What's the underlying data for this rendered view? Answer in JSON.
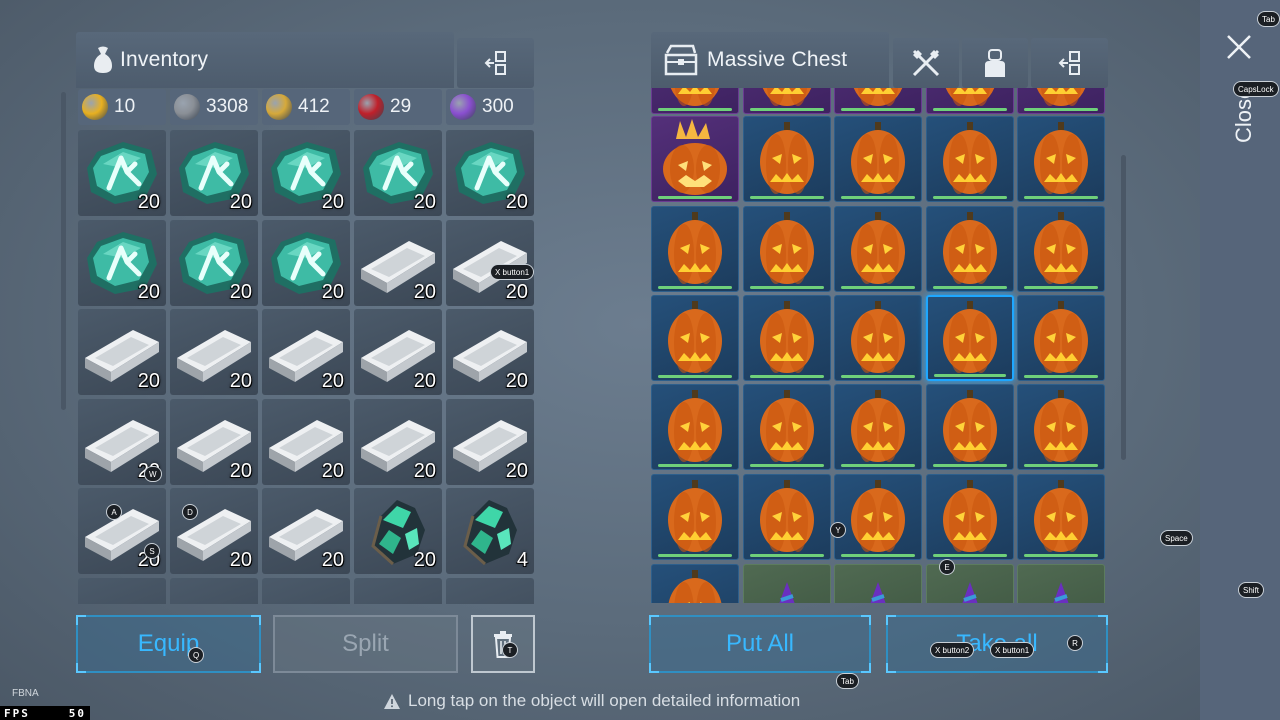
{
  "inventory": {
    "title": "Inventory",
    "currencies": [
      {
        "icon": "gold-coin-icon",
        "value": "10",
        "color": "#e8b020"
      },
      {
        "icon": "chip-icon",
        "value": "3308",
        "color": "#8a8f96"
      },
      {
        "icon": "crown-icon",
        "value": "412",
        "color": "#d6a93a"
      },
      {
        "icon": "red-emblem-icon",
        "value": "29",
        "color": "#c0202a"
      },
      {
        "icon": "crystal-icon",
        "value": "300",
        "color": "#8a4fd0"
      }
    ],
    "slots": [
      {
        "item": "rune-stone",
        "count": "20"
      },
      {
        "item": "rune-stone",
        "count": "20"
      },
      {
        "item": "rune-stone",
        "count": "20"
      },
      {
        "item": "rune-stone",
        "count": "20"
      },
      {
        "item": "rune-stone",
        "count": "20"
      },
      {
        "item": "rune-stone",
        "count": "20"
      },
      {
        "item": "rune-stone",
        "count": "20"
      },
      {
        "item": "rune-stone",
        "count": "20"
      },
      {
        "item": "metal-ingot",
        "count": "20"
      },
      {
        "item": "metal-ingot",
        "count": "20"
      },
      {
        "item": "metal-ingot",
        "count": "20"
      },
      {
        "item": "metal-ingot",
        "count": "20"
      },
      {
        "item": "metal-ingot",
        "count": "20"
      },
      {
        "item": "metal-ingot",
        "count": "20"
      },
      {
        "item": "metal-ingot",
        "count": "20"
      },
      {
        "item": "metal-ingot",
        "count": "20"
      },
      {
        "item": "metal-ingot",
        "count": "20"
      },
      {
        "item": "metal-ingot",
        "count": "20"
      },
      {
        "item": "metal-ingot",
        "count": "20"
      },
      {
        "item": "metal-ingot",
        "count": "20"
      },
      {
        "item": "metal-ingot",
        "count": "20"
      },
      {
        "item": "metal-ingot",
        "count": "20"
      },
      {
        "item": "metal-ingot",
        "count": "20"
      },
      {
        "item": "green-ore",
        "count": "20"
      },
      {
        "item": "green-ore",
        "count": "4"
      }
    ],
    "buttons": {
      "equip": "Equip",
      "split": "Split"
    }
  },
  "chest": {
    "title": "Massive Chest",
    "buttons": {
      "put_all": "Put All",
      "take_all": "Take all"
    }
  },
  "keys": {
    "tab": "Tab",
    "capslock": "CapsLock",
    "space": "Space",
    "shift": "Shift",
    "xbutton1": "X button1",
    "xbutton2": "X button2",
    "q": "Q",
    "t": "T",
    "w": "W",
    "a": "A",
    "d": "D",
    "s": "S",
    "y": "Y",
    "e": "E",
    "r": "R"
  },
  "close_label": "Close",
  "hint": "Long tap on the object will open detailed information",
  "overlay": {
    "fbna": "FBNA",
    "fps_label": "FPS",
    "fps_value": "50"
  }
}
